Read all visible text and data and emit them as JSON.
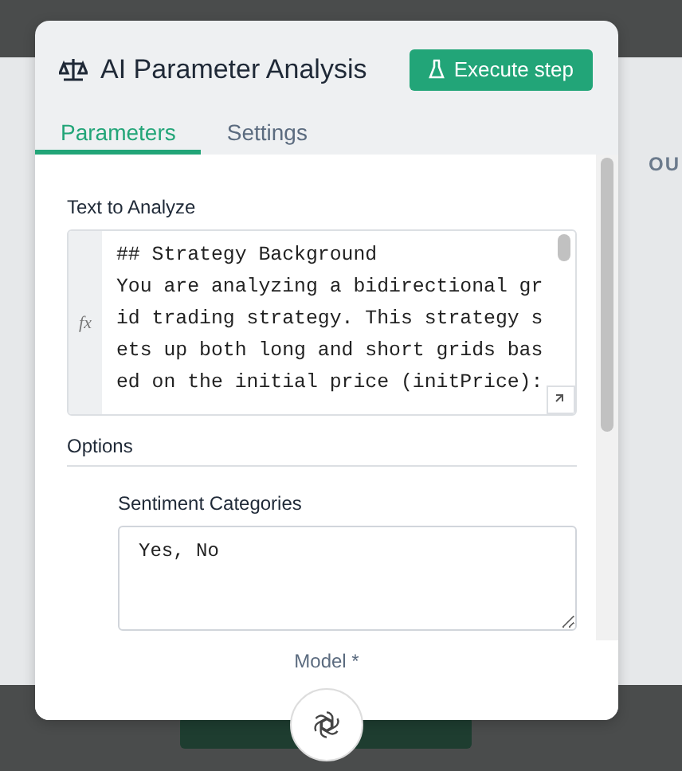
{
  "background": {
    "column_heading": "OU"
  },
  "dialog": {
    "title": "AI Parameter Analysis",
    "action": "Execute step",
    "tabs": [
      {
        "label": "Parameters",
        "selected": true
      },
      {
        "label": "Settings",
        "selected": false
      }
    ],
    "text_field": {
      "label": "Text to Analyze",
      "gutter": "fx",
      "value": "## Strategy Background\nYou are analyzing a bidirectional grid trading strategy. This strategy sets up both long and short grids based on the initial price (initPrice):"
    },
    "section": "Options",
    "categories": {
      "label": "Sentiment Categories",
      "value": "Yes, No"
    },
    "model": {
      "label": "Model *"
    }
  }
}
